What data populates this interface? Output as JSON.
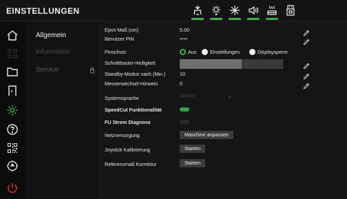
{
  "header": {
    "title": "EINSTELLUNGEN",
    "status_icons": [
      {
        "name": "device-icon",
        "indicator_color": "#3fb14a"
      },
      {
        "name": "light-icon",
        "indicator_color": "#3fb14a"
      },
      {
        "name": "fan-icon",
        "indicator_color": "#3fb14a"
      },
      {
        "name": "sound-icon",
        "indicator_color": "#3fb14a"
      },
      {
        "name": "heater-icon",
        "indicator_color": "#3fb14a"
      },
      {
        "name": "usb-icon",
        "indicator_color": ""
      }
    ]
  },
  "rail": {
    "icons": [
      "home-icon",
      "grid-icon",
      "folder-icon",
      "door-icon",
      "gear-icon",
      "help-icon",
      "qr-code-icon",
      "dial-icon",
      "power-icon"
    ],
    "active": "gear-icon"
  },
  "subnav": {
    "items": [
      {
        "label": "Allgemein",
        "active": true
      },
      {
        "label": "Information",
        "active": false
      },
      {
        "label": "Service",
        "active": false,
        "locked": true
      }
    ]
  },
  "settings": {
    "eject_label": "Eject-Maß (cm)",
    "eject_value": "5.00",
    "pin_label": "Benutzer PIN",
    "pin_value": "****",
    "pinschutz_label": "Pinschutz",
    "pinschutz_options": [
      "Aus",
      "Einstellungen",
      "Displaysperre"
    ],
    "pinschutz_selected": "Aus",
    "brightness_label": "Schnittttaster-Helligkeit",
    "brightness_level": 0.6,
    "standby_label": "Standby-Modus nach (Min.)",
    "standby_value": "10",
    "knife_label": "Messerwechsel-Hinweis",
    "knife_value": "0",
    "language_label": "Systemsprache",
    "language_value": "Deutsch",
    "speedcut_label": "SpeedCut Funktionalität",
    "speedcut_on": true,
    "fu_label": "FU Strom Diagnose",
    "fu_on": false,
    "power_label": "Netzversorgung",
    "power_button": "Maschine anpassen",
    "joystick_label": "Joystick Kalibrierung",
    "joystick_button": "Starten",
    "reference_label": "Referenzmaß Korrektur",
    "reference_button": "Starten"
  },
  "colors": {
    "accent_green": "#41b64a",
    "power_red": "#d93030",
    "toggle_on": "#2fa44a",
    "toggle_off": "#2a2a2d"
  }
}
